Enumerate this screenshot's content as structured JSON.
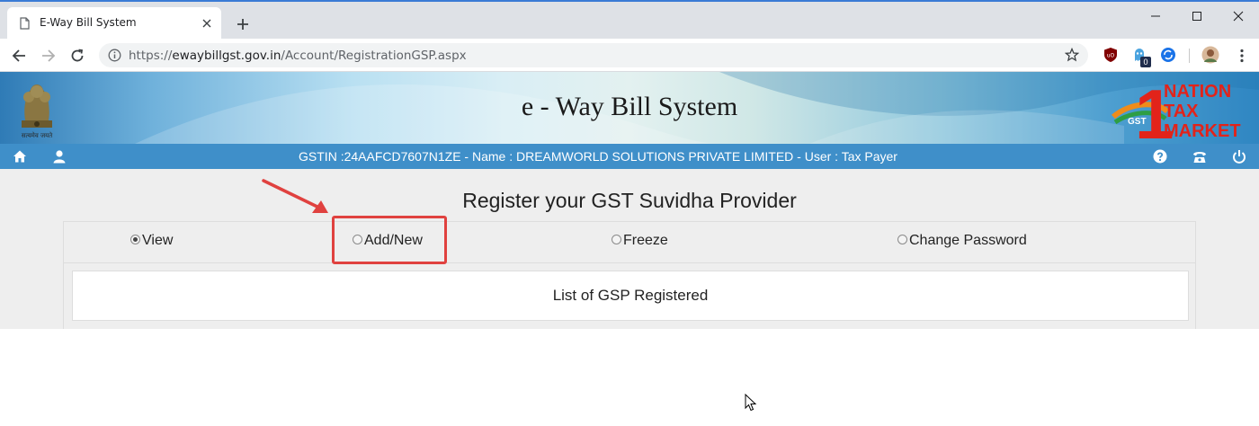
{
  "browser": {
    "tab_title": "E-Way Bill System",
    "url_scheme": "https://",
    "url_host": "ewaybillgst.gov.in",
    "url_path": "/Account/RegistrationGSP.aspx",
    "extension_badge": "0"
  },
  "header": {
    "emblem_caption": "सत्यमेव जयते",
    "title": "e - Way Bill System",
    "logo_text": [
      "NATION",
      "TAX",
      "MARKET"
    ],
    "logo_number": "1",
    "logo_badge": "GST"
  },
  "navbar": {
    "user_info": "GSTIN :24AAFCD7607N1ZE - Name : DREAMWORLD SOLUTIONS PRIVATE LIMITED - User : Tax Payer"
  },
  "page": {
    "heading": "Register your GST Suvidha Provider",
    "options": [
      {
        "label": "View",
        "selected": true
      },
      {
        "label": "Add/New",
        "selected": false
      },
      {
        "label": "Freeze",
        "selected": false
      },
      {
        "label": "Change Password",
        "selected": false
      }
    ],
    "list_title": "List of GSP Registered"
  },
  "colors": {
    "navbar": "#3f8fc9",
    "highlight": "#e0413f",
    "accent_blue": "#3a7bd5"
  }
}
